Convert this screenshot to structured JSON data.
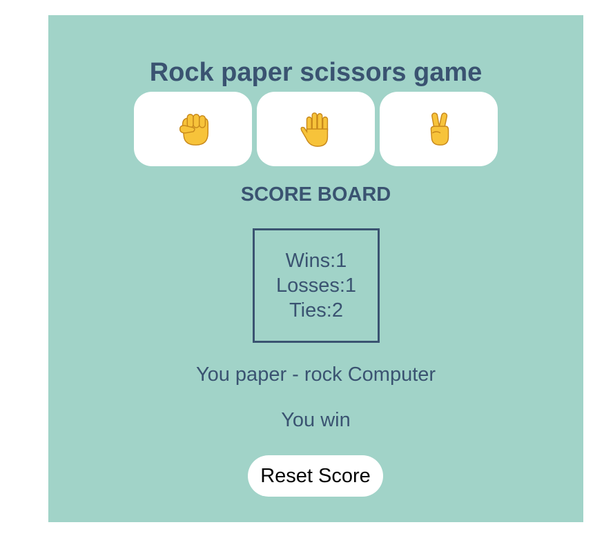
{
  "title": "Rock paper scissors game",
  "choices": [
    {
      "name": "rock",
      "icon": "raised-fist-icon"
    },
    {
      "name": "paper",
      "icon": "raised-hand-icon"
    },
    {
      "name": "scissors",
      "icon": "victory-hand-icon"
    }
  ],
  "scoreboard": {
    "title": "SCORE BOARD",
    "wins": "Wins:1",
    "losses": "Losses:1",
    "ties": "Ties:2"
  },
  "moves_text": "You paper - rock Computer",
  "result_text": "You win",
  "reset_label": "Reset Score",
  "colors": {
    "background": "#a1d3c8",
    "text": "#3a5371",
    "button": "#ffffff",
    "emoji": "#f7c33a"
  }
}
